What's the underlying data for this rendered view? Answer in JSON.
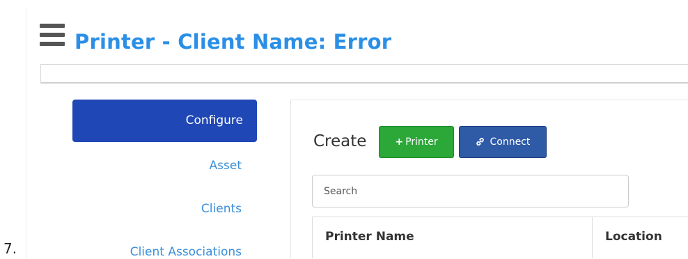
{
  "list_marker": "7.",
  "header": {
    "title": "Printer - Client Name: Error",
    "menu_icon": "hamburger-menu-icon"
  },
  "sidebar": {
    "items": [
      {
        "label": "Configure",
        "active": true
      },
      {
        "label": "Asset"
      },
      {
        "label": "Clients"
      },
      {
        "label": "Client Associations"
      }
    ]
  },
  "toolbar": {
    "create_label": "Create",
    "printer_button": {
      "icon": "plus-icon",
      "label": "Printer"
    },
    "connect_button": {
      "icon": "link-icon",
      "label": "Connect"
    }
  },
  "search": {
    "placeholder": "Search",
    "value": ""
  },
  "table": {
    "columns": [
      "Printer Name",
      "Location"
    ]
  },
  "colors": {
    "title": "#2b8fe6",
    "active_nav": "#1f47b5",
    "nav_link": "#3b8fd8",
    "printer_button": "#2ba838",
    "connect_button": "#2f5aa6"
  }
}
